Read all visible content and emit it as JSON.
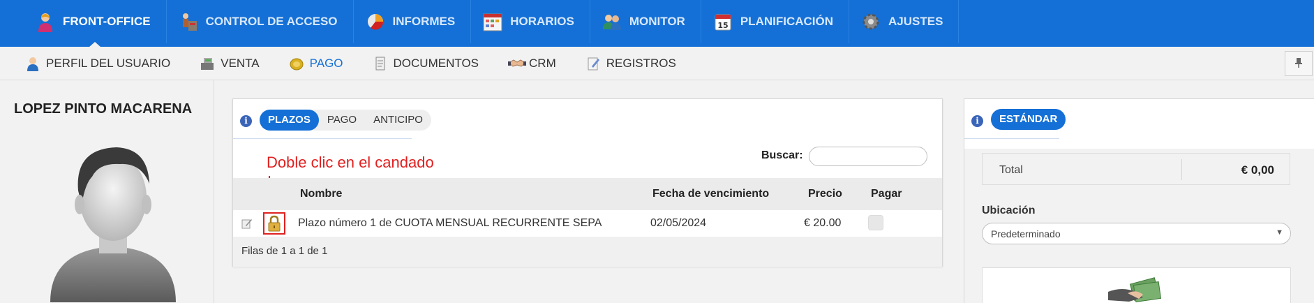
{
  "topnav": {
    "items": [
      {
        "label": "FRONT-OFFICE",
        "icon": "user-icon",
        "active": true
      },
      {
        "label": "CONTROL DE ACCESO",
        "icon": "turnstile-icon",
        "active": false
      },
      {
        "label": "INFORMES",
        "icon": "pie-chart-icon",
        "active": false
      },
      {
        "label": "HORARIOS",
        "icon": "calendar-grid-icon",
        "active": false
      },
      {
        "label": "MONITOR",
        "icon": "users-icon",
        "active": false
      },
      {
        "label": "PLANIFICACIÓN",
        "icon": "calendar-icon",
        "active": false
      },
      {
        "label": "AJUSTES",
        "icon": "gear-icon",
        "active": false
      }
    ]
  },
  "subnav": {
    "items": [
      {
        "label": "PERFIL DEL USUARIO",
        "icon": "user-icon",
        "active": false
      },
      {
        "label": "VENTA",
        "icon": "cash-register-icon",
        "active": false
      },
      {
        "label": "PAGO",
        "icon": "coins-icon",
        "active": true
      },
      {
        "label": "DOCUMENTOS",
        "icon": "document-icon",
        "active": false
      },
      {
        "label": "CRM",
        "icon": "handshake-icon",
        "active": false
      },
      {
        "label": "REGISTROS",
        "icon": "notepad-icon",
        "active": false
      }
    ],
    "pin_icon": "pin-icon"
  },
  "profile": {
    "name": "LOPEZ PINTO MACARENA"
  },
  "payments": {
    "tabs": [
      "PLAZOS",
      "PAGO",
      "ANTICIPO"
    ],
    "active_tab": "PLAZOS",
    "search_label": "Buscar:",
    "search_value": "",
    "annotation": "Doble clic en el candado",
    "columns": [
      "Nombre",
      "Fecha de vencimiento",
      "Precio",
      "Pagar"
    ],
    "rows": [
      {
        "name": "Plazo número 1 de CUOTA MENSUAL RECURRENTE SEPA",
        "due_date": "02/05/2024",
        "price": "€ 20.00"
      }
    ],
    "footer": "Filas de 1 a 1 de 1"
  },
  "summary": {
    "tab": "ESTÁNDAR",
    "total_label": "Total",
    "total_value": "€ 0,00",
    "location_label": "Ubicación",
    "location_value": "Predeterminado"
  },
  "colors": {
    "brand": "#1470d6",
    "annotation": "#e02020"
  }
}
